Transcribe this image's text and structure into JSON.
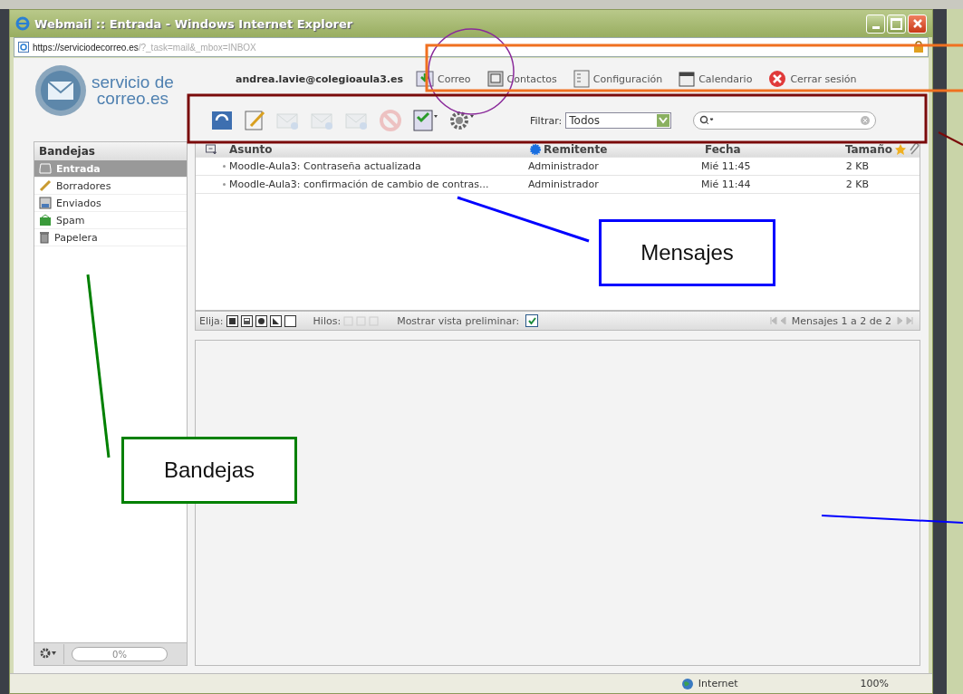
{
  "window": {
    "title": "Webmail :: Entrada - Windows Internet Explorer"
  },
  "address": {
    "domain": "https://serviciodecorreo.es",
    "path": "/?_task=mail&_mbox=INBOX"
  },
  "logo": {
    "line_1": "servicio de",
    "line_2": "correo.es"
  },
  "user": "andrea.lavie@colegioaula3.es",
  "nav": [
    {
      "kind": "mail",
      "label": "Correo"
    },
    {
      "kind": "contacts",
      "label": "Contactos"
    },
    {
      "kind": "settings",
      "label": "Configuración"
    },
    {
      "kind": "calendar",
      "label": "Calendario"
    },
    {
      "kind": "logout",
      "label": "Cerrar sesión"
    }
  ],
  "toolbar": {
    "buttons": [
      {
        "kind": "refresh",
        "disabled": false
      },
      {
        "kind": "compose",
        "disabled": false
      },
      {
        "kind": "reply",
        "disabled": true
      },
      {
        "kind": "reply-all",
        "disabled": true
      },
      {
        "kind": "forward",
        "disabled": true
      },
      {
        "kind": "delete",
        "disabled": true
      },
      {
        "kind": "mark",
        "disabled": false
      },
      {
        "kind": "more",
        "disabled": false
      }
    ],
    "filter_label": "Filtrar:",
    "filter_value": "Todos"
  },
  "sidebar": {
    "title": "Bandejas",
    "folders": [
      {
        "kind": "inbox",
        "label": "Entrada",
        "selected": true
      },
      {
        "kind": "drafts",
        "label": "Borradores",
        "selected": false
      },
      {
        "kind": "sent",
        "label": "Enviados",
        "selected": false
      },
      {
        "kind": "spam",
        "label": "Spam",
        "selected": false
      },
      {
        "kind": "trash",
        "label": "Papelera",
        "selected": false
      }
    ],
    "quota": {
      "reading": "0%"
    }
  },
  "messages": {
    "columns": [
      "Asunto",
      "Remitente",
      "Fecha",
      "Tamaño"
    ],
    "rows": [
      {
        "subject": "Moodle-Aula3: Contraseña actualizada",
        "from": "Administrador",
        "date": "Mié 11:45",
        "size": "2 KB"
      },
      {
        "subject": "Moodle-Aula3: confirmación de cambio de contras...",
        "from": "Administrador",
        "date": "Mié 11:44",
        "size": "2 KB"
      }
    ]
  },
  "list_footer": {
    "select_label": "Elija:",
    "threads_label": "Hilos:",
    "preview_label": "Mostrar vista preliminar:",
    "preview_checked": true,
    "count": "Mensajes 1 a 2 de 2"
  },
  "status_bar": {
    "zone": "Internet",
    "zoom": "100%"
  },
  "callouts": [
    {
      "label": "Mensajes",
      "color": "#0000ff"
    },
    {
      "label": "Bandejas",
      "color": "#008000"
    }
  ]
}
